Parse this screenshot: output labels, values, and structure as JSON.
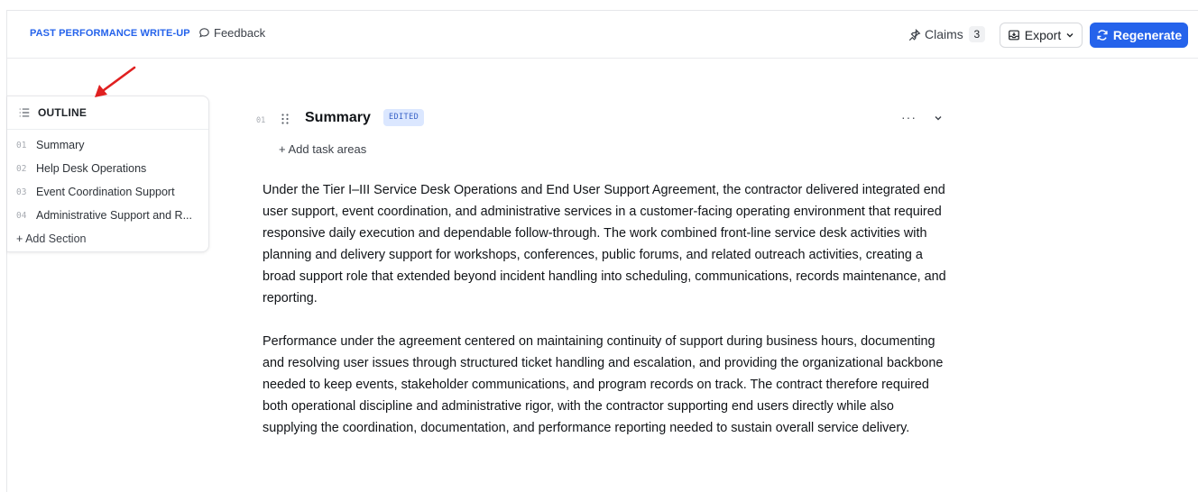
{
  "header": {
    "title": "PAST PERFORMANCE WRITE-UP",
    "feedback_label": "Feedback",
    "claims_label": "Claims",
    "claims_count": "3",
    "export_label": "Export",
    "regenerate_label": "Regenerate"
  },
  "outline": {
    "title": "OUTLINE",
    "items": [
      {
        "num": "01",
        "label": "Summary"
      },
      {
        "num": "02",
        "label": "Help Desk Operations"
      },
      {
        "num": "03",
        "label": "Event Coordination Support"
      },
      {
        "num": "04",
        "label": "Administrative Support and R..."
      }
    ],
    "add_label": "+ Add Section"
  },
  "section": {
    "num": "01",
    "title": "Summary",
    "badge": "EDITED",
    "more": "···",
    "add_task_label": "+ Add task areas",
    "paragraphs": [
      "Under the Tier I–III Service Desk Operations and End User Support Agreement, the contractor delivered integrated end user support, event coordination, and administrative services in a customer-facing operating environment that required responsive daily execution and dependable follow-through. The work combined front-line service desk activities with planning and delivery support for workshops, conferences, public forums, and related outreach activities, creating a broad support role that extended beyond incident handling into scheduling, communications, records maintenance, and reporting.",
      "Performance under the agreement centered on maintaining continuity of support during business hours, documenting and resolving user issues through structured ticket handling and escalation, and providing the organizational backbone needed to keep events, stakeholder communications, and program records on track. The contract therefore required both operational discipline and administrative rigor, with the contractor supporting end users directly while also supplying the coordination, documentation, and performance reporting needed to sustain overall service delivery."
    ]
  },
  "colors": {
    "accent": "#2563eb",
    "badge_bg": "#dbe7ff",
    "arrow": "#e02020"
  },
  "icons": [
    "feedback-icon",
    "claims-icon",
    "export-icon",
    "chevron-down-icon",
    "regenerate-icon",
    "outline-list-icon",
    "drag-handle-icon",
    "collapse-chevron-icon",
    "red-arrow-annotation"
  ]
}
